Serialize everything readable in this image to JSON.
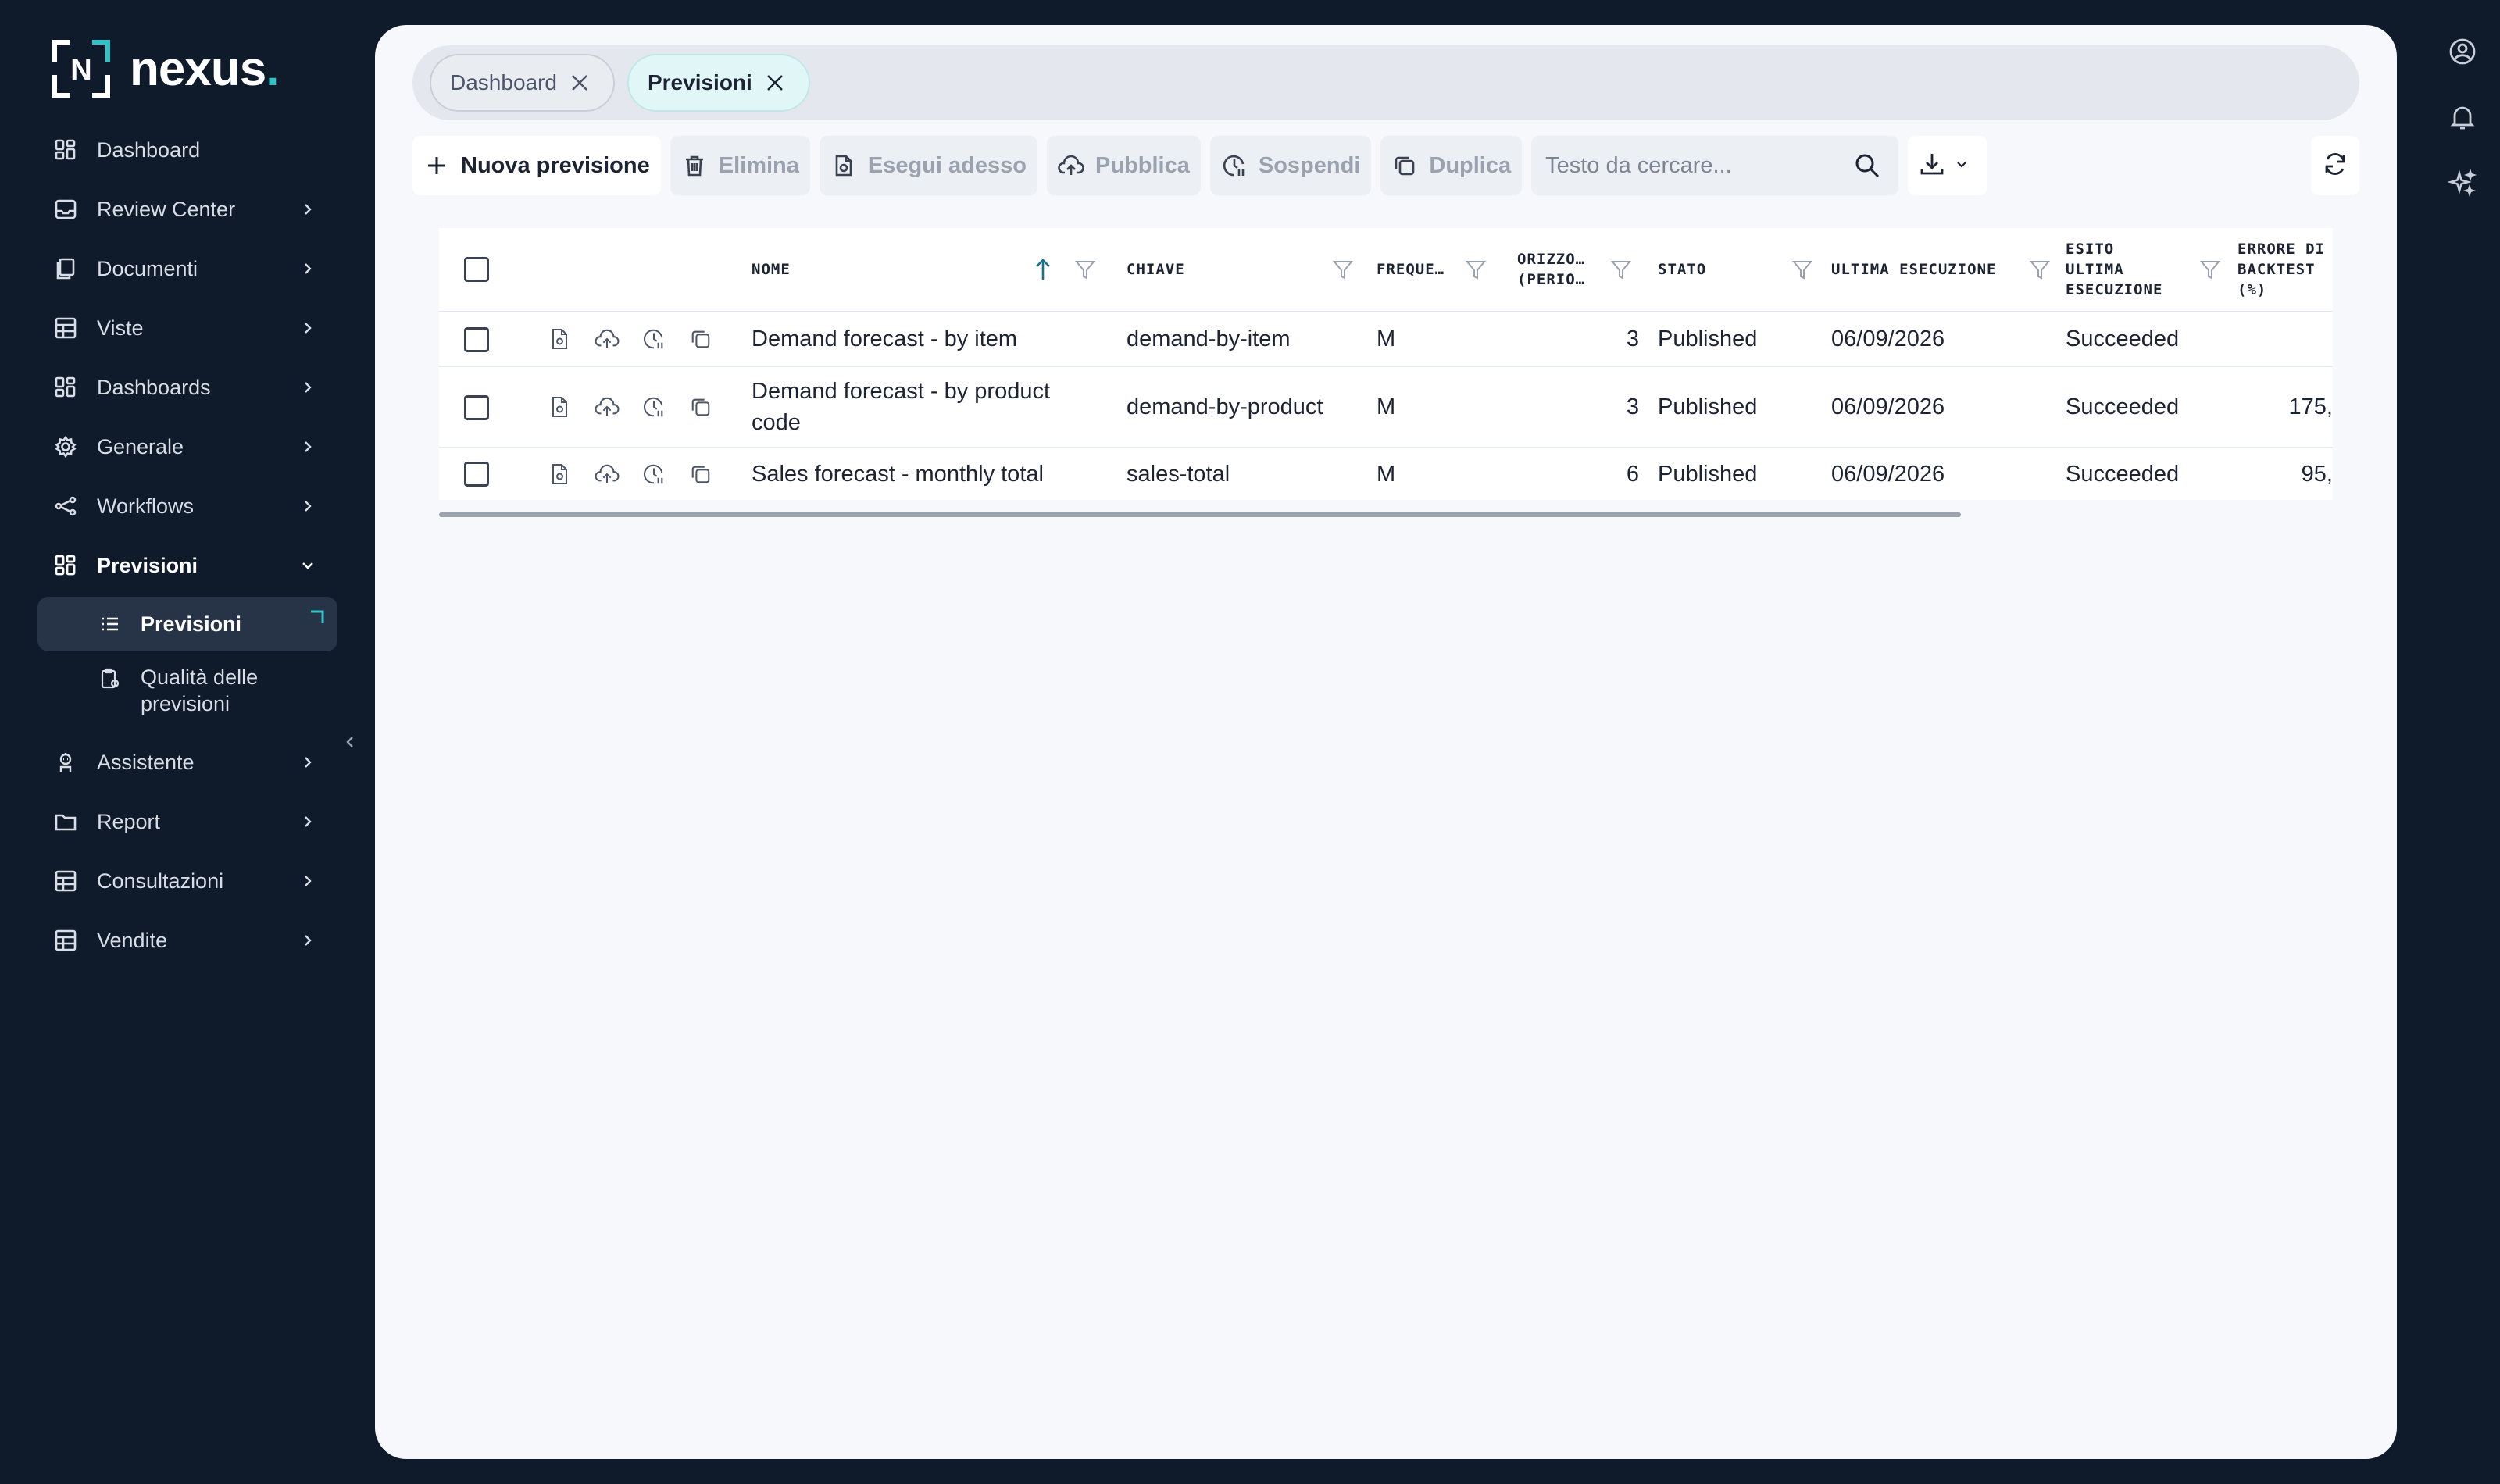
{
  "app": {
    "logo_text": "nexus",
    "logo_dot": ".",
    "logo_mark_letter": "N"
  },
  "sidebar": {
    "items": [
      {
        "label": "Dashboard",
        "icon": "grid-icon",
        "has_chevron": false
      },
      {
        "label": "Review Center",
        "icon": "inbox-icon",
        "has_chevron": true
      },
      {
        "label": "Documenti",
        "icon": "documents-icon",
        "has_chevron": true
      },
      {
        "label": "Viste",
        "icon": "table-icon",
        "has_chevron": true
      },
      {
        "label": "Dashboards",
        "icon": "grid-icon",
        "has_chevron": true
      },
      {
        "label": "Generale",
        "icon": "gear-icon",
        "has_chevron": true
      },
      {
        "label": "Workflows",
        "icon": "share-nodes-icon",
        "has_chevron": true
      },
      {
        "label": "Previsioni",
        "icon": "grid-icon",
        "has_chevron": true,
        "expanded": true
      },
      {
        "label": "Assistente",
        "icon": "robot-icon",
        "has_chevron": true
      },
      {
        "label": "Report",
        "icon": "folder-icon",
        "has_chevron": true
      },
      {
        "label": "Consultazioni",
        "icon": "table-icon",
        "has_chevron": true
      },
      {
        "label": "Vendite",
        "icon": "table-icon",
        "has_chevron": true
      }
    ],
    "sub_items": [
      {
        "label": "Previsioni",
        "icon": "list-icon",
        "selected": true
      },
      {
        "label": "Qualità delle previsioni",
        "icon": "clipboard-gear-icon",
        "selected": false
      }
    ]
  },
  "tabs": [
    {
      "label": "Dashboard",
      "active": false
    },
    {
      "label": "Previsioni",
      "active": true
    }
  ],
  "toolbar": {
    "new_label": "Nuova previsione",
    "delete_label": "Elimina",
    "run_label": "Esegui adesso",
    "publish_label": "Pubblica",
    "suspend_label": "Sospendi",
    "duplicate_label": "Duplica",
    "search_placeholder": "Testo da cercare..."
  },
  "grid": {
    "columns": [
      {
        "key": "nome",
        "label": "NOME",
        "sorted": "asc"
      },
      {
        "key": "chiave",
        "label": "CHIAVE"
      },
      {
        "key": "frequenza",
        "label": "FREQUE…"
      },
      {
        "key": "orizzonte",
        "label": "ORIZZO…\n(PERIO…"
      },
      {
        "key": "stato",
        "label": "STATO"
      },
      {
        "key": "ultima",
        "label": "ULTIMA ESECUZIONE"
      },
      {
        "key": "esito",
        "label": "ESITO\nULTIMA\nESECUZIONE"
      },
      {
        "key": "errore",
        "label": "ERRORE DI\nBACKTEST\n(%)"
      }
    ],
    "rows": [
      {
        "nome": "Demand forecast - by item",
        "chiave": "demand-by-item",
        "frequenza": "M",
        "orizzonte": "3",
        "stato": "Published",
        "ultima": "06/09/2026",
        "esito": "Succeeded",
        "errore": ""
      },
      {
        "nome": "Demand forecast - by product code",
        "chiave": "demand-by-product",
        "frequenza": "M",
        "orizzonte": "3",
        "stato": "Published",
        "ultima": "06/09/2026",
        "esito": "Succeeded",
        "errore": "175,"
      },
      {
        "nome": "Sales forecast - monthly total",
        "chiave": "sales-total",
        "frequenza": "M",
        "orizzonte": "6",
        "stato": "Published",
        "ultima": "06/09/2026",
        "esito": "Succeeded",
        "errore": "95,"
      }
    ]
  },
  "colors": {
    "sidebar_bg": "#0f1a2b",
    "accent": "#2fc3c6",
    "sort_arrow": "#1a6f8a",
    "content_bg": "#f7f8fb"
  }
}
